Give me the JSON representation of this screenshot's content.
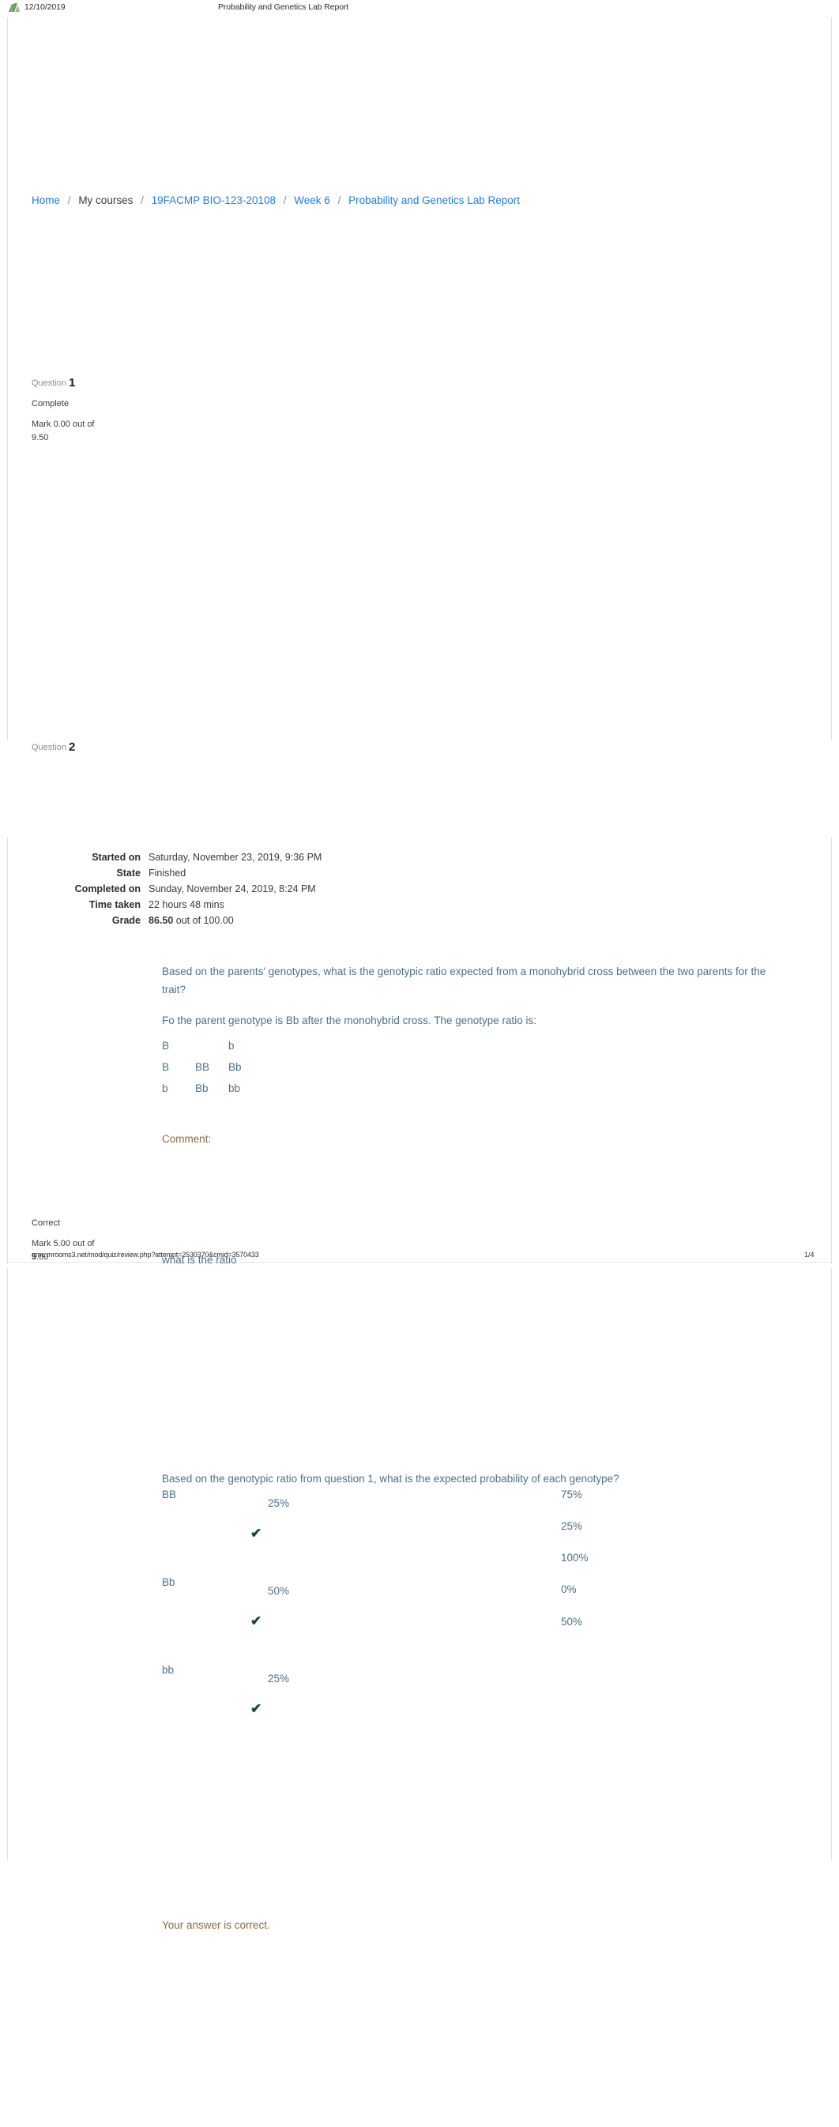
{
  "print_header": {
    "date": "12/10/2019",
    "document_title": "Probability and Genetics Lab Report",
    "logo_icon": "moodle-logo-icon"
  },
  "breadcrumb": {
    "separator": "/",
    "items": [
      {
        "label": "Home",
        "link": true
      },
      {
        "label": "My courses",
        "link": false
      },
      {
        "label": "19FACMP BIO-123-20108",
        "link": true
      },
      {
        "label": "Week 6",
        "link": true
      },
      {
        "label": "Probability and Genetics Lab Report",
        "link": true
      }
    ]
  },
  "quiz_summary": {
    "rows": [
      {
        "label": "Started on",
        "value": "Saturday, November 23, 2019, 9:36 PM"
      },
      {
        "label": "State",
        "value": "Finished"
      },
      {
        "label": "Completed on",
        "value": "Sunday, November 24, 2019, 8:24 PM"
      },
      {
        "label": "Time taken",
        "value": "22 hours 48 mins"
      }
    ],
    "grade_label": "Grade",
    "grade_value": "86.50",
    "grade_suffix": "out of 100.00"
  },
  "questions": [
    {
      "number_label": "Question",
      "number": "1",
      "state": "Complete",
      "mark_line1": "Mark 0.00 out of",
      "mark_line2": "9.50",
      "stem": "Based on the parents' genotypes, what is the genotypic ratio expected from a monohybrid cross between the two parents for the trait?",
      "answer_intro": "Fo the parent genotype is Bb after the monohybrid cross. The genotype ratio is:",
      "punnett": [
        [
          "B",
          "",
          "b"
        ],
        [
          "B",
          "BB",
          "Bb"
        ],
        [
          "b",
          "Bb",
          "bb"
        ]
      ],
      "comment_label": "Comment:"
    },
    {
      "number_label": "Question",
      "number": "2",
      "state": "Correct",
      "mark_line1": "Mark 5.00 out of",
      "mark_line2": "5.00",
      "stem_tail": "what is the ratio",
      "stem": "Based on the genotypic ratio from question 1, what is the expected probability of each genotype?",
      "rows": [
        {
          "label": "BB",
          "value": "25%",
          "check": "✔"
        },
        {
          "label": "Bb",
          "value": "50%",
          "check": "✔"
        },
        {
          "label": "bb",
          "value": "25%",
          "check": "✔"
        }
      ],
      "options": [
        "75%",
        "25%",
        "100%",
        "0%",
        "50%"
      ],
      "feedback": "Your answer is correct."
    }
  ],
  "print_footer": {
    "url": "gmc.mrooms3.net/mod/quiz/review.php?attempt=2530370&cmid=3570433",
    "page_number": "1/4"
  },
  "colors": {
    "link": "#1f7ee0",
    "question_text": "#4b7287",
    "comment": "#8a6d3b",
    "check": "#1a4a2e",
    "logo_green": "#4caf2f"
  }
}
